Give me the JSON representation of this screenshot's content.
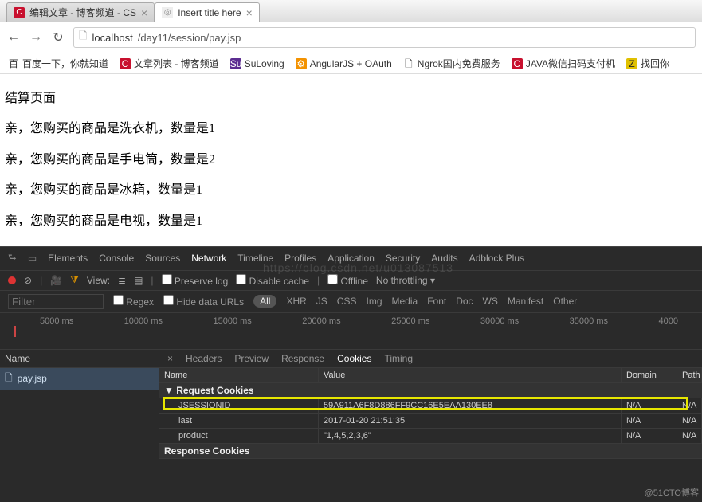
{
  "browser": {
    "tabs": [
      {
        "title": "编辑文章 - 博客频道 - CS",
        "active": false,
        "favicon": "C"
      },
      {
        "title": "Insert title here",
        "active": true,
        "favicon": "◎"
      }
    ],
    "nav": {
      "back": "←",
      "forward": "→",
      "reload": "↻"
    },
    "url": {
      "host": "localhost",
      "path": "/day11/session/pay.jsp"
    },
    "bookmarks": [
      {
        "label": "百度一下，你就知道",
        "icon": "百",
        "cls": ""
      },
      {
        "label": "文章列表 - 博客频道",
        "icon": "C",
        "cls": "fav-red"
      },
      {
        "label": "SuLoving",
        "icon": "Su",
        "cls": "fav-purple"
      },
      {
        "label": "AngularJS + OAuth",
        "icon": "⚙",
        "cls": "fav-orange"
      },
      {
        "label": "Ngrok国内免费服务",
        "icon": "🗋",
        "cls": ""
      },
      {
        "label": "JAVA微信扫码支付机",
        "icon": "C",
        "cls": "fav-red"
      },
      {
        "label": "找回你",
        "icon": "Z",
        "cls": "fav-yellow"
      }
    ]
  },
  "page": {
    "heading": "结算页面",
    "lines": [
      "亲，您购买的商品是洗衣机，数量是1",
      "亲，您购买的商品是手电筒，数量是2",
      "亲，您购买的商品是冰箱，数量是1",
      "亲，您购买的商品是电视，数量是1"
    ]
  },
  "watermark_center": "https://blog.csdn.net/u013087513",
  "watermark_corner": "@51CTO博客",
  "devtools": {
    "panels": [
      "Elements",
      "Console",
      "Sources",
      "Network",
      "Timeline",
      "Profiles",
      "Application",
      "Security",
      "Audits",
      "Adblock Plus"
    ],
    "active_panel": "Network",
    "toolbar": {
      "view_label": "View:",
      "preserve": "Preserve log",
      "disable_cache": "Disable cache",
      "offline": "Offline",
      "throttling": "No throttling"
    },
    "filter": {
      "placeholder": "Filter",
      "regex": "Regex",
      "hide_urls": "Hide data URLs",
      "all": "All",
      "types": [
        "XHR",
        "JS",
        "CSS",
        "Img",
        "Media",
        "Font",
        "Doc",
        "WS",
        "Manifest",
        "Other"
      ]
    },
    "timeline_ticks": [
      "5000 ms",
      "10000 ms",
      "15000 ms",
      "20000 ms",
      "25000 ms",
      "30000 ms",
      "35000 ms",
      "4000"
    ],
    "requests": {
      "header": "Name",
      "items": [
        {
          "name": "pay.jsp"
        }
      ]
    },
    "detail_tabs": [
      "Headers",
      "Preview",
      "Response",
      "Cookies",
      "Timing"
    ],
    "detail_active": "Cookies",
    "cookies": {
      "columns": [
        "Name",
        "Value",
        "Domain",
        "Path"
      ],
      "request_group": "Request Cookies",
      "response_group": "Response Cookies",
      "rows": [
        {
          "name": "JSESSIONID",
          "value": "59A911A6F8D886FF9CC16E5EAA130EE8",
          "domain": "N/A",
          "path": "N/A"
        },
        {
          "name": "last",
          "value": "2017-01-20 21:51:35",
          "domain": "N/A",
          "path": "N/A"
        },
        {
          "name": "product",
          "value": "\"1,4,5,2,3,6\"",
          "domain": "N/A",
          "path": "N/A"
        }
      ]
    }
  }
}
